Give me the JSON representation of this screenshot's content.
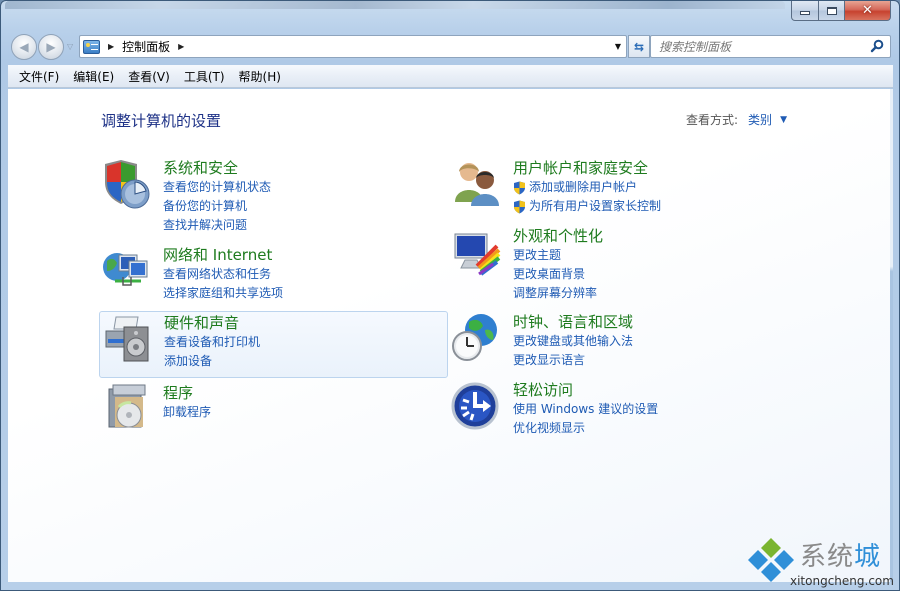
{
  "window": {
    "caption_buttons": {
      "minimize_icon": "minimize-icon",
      "maximize_icon": "maximize-icon",
      "close_icon": "close-icon",
      "close_glyph": "✕"
    }
  },
  "navigation": {
    "back_glyph": "◀",
    "forward_glyph": "▶",
    "history_glyph": "▽",
    "address": {
      "icon": "control-panel-icon",
      "breadcrumb": [
        "控制面板"
      ],
      "separator_glyph": "▶",
      "dropdown_glyph": "▼"
    },
    "refresh_glyph": "⇆",
    "search": {
      "placeholder": "搜索控制面板",
      "value": ""
    }
  },
  "menubar": {
    "items": [
      "文件(F)",
      "编辑(E)",
      "查看(V)",
      "工具(T)",
      "帮助(H)"
    ]
  },
  "content": {
    "title": "调整计算机的设置",
    "view_by": {
      "label": "查看方式:",
      "value": "类别",
      "arrow_glyph": "▼"
    },
    "categories_left": [
      {
        "title": "系统和安全",
        "icon": "security-shield-icon",
        "links": [
          "查看您的计算机状态",
          "备份您的计算机",
          "查找并解决问题"
        ]
      },
      {
        "title": "网络和 Internet",
        "icon": "network-globe-icon",
        "links": [
          "查看网络状态和任务",
          "选择家庭组和共享选项"
        ]
      },
      {
        "title": "硬件和声音",
        "icon": "printer-speaker-icon",
        "links": [
          "查看设备和打印机",
          "添加设备"
        ],
        "hovered": true
      },
      {
        "title": "程序",
        "icon": "programs-disc-icon",
        "links": [
          "卸载程序"
        ]
      }
    ],
    "categories_right": [
      {
        "title": "用户帐户和家庭安全",
        "icon": "users-icon",
        "links": [
          "添加或删除用户帐户",
          "为所有用户设置家长控制"
        ],
        "links_have_uac_shield": true
      },
      {
        "title": "外观和个性化",
        "icon": "monitor-palette-icon",
        "links": [
          "更改主题",
          "更改桌面背景",
          "调整屏幕分辨率"
        ]
      },
      {
        "title": "时钟、语言和区域",
        "icon": "clock-globe-icon",
        "links": [
          "更改键盘或其他输入法",
          "更改显示语言"
        ]
      },
      {
        "title": "轻松访问",
        "icon": "ease-of-access-icon",
        "links": [
          "使用 Windows 建议的设置",
          "优化视频显示"
        ]
      }
    ]
  },
  "watermark": {
    "brand_gray": "系统",
    "brand_accent": "城",
    "url": "xitongcheng.com",
    "accent_color": "#2f8fd8",
    "logo_colors": [
      "#7ab530",
      "#2f8fd8"
    ]
  },
  "colors": {
    "category_title": "#1e7b1e",
    "link": "#1f5bb4",
    "page_title": "#1e3287"
  }
}
